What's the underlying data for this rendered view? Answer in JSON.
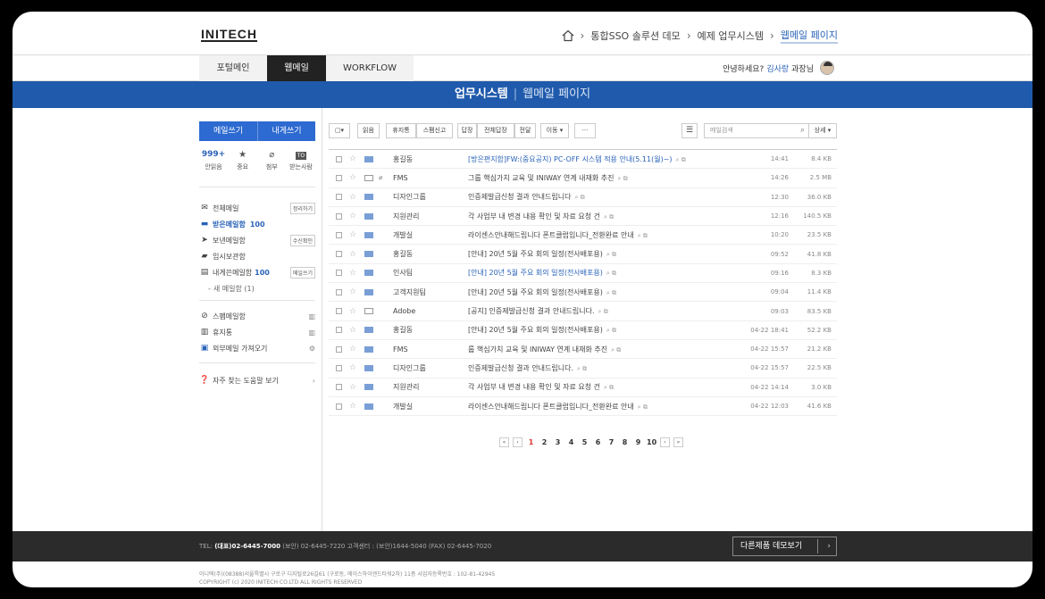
{
  "header": {
    "logo": "INITECH",
    "breadcrumb": [
      "통합SSO 솔루션 데모",
      "예제 업무시스템",
      "웹메일 페이지"
    ]
  },
  "nav": {
    "tabs": [
      "포털메인",
      "웹메일",
      "WORKFLOW"
    ],
    "active_tab": "웹메일",
    "greeting": "안녕하세요?",
    "user_name": "김사랑",
    "user_title": "과장님"
  },
  "banner": {
    "title": "업무시스템",
    "subtitle": "웹메일 페이지"
  },
  "sidebar": {
    "write_mail": "메일쓰기",
    "write_self": "내게쓰기",
    "quick": [
      {
        "value": "999+",
        "label": "안읽음"
      },
      {
        "icon": "star-icon",
        "label": "중요"
      },
      {
        "icon": "clip-icon",
        "label": "첨부"
      },
      {
        "badge": "TO",
        "label": "받는사람"
      }
    ],
    "menu": [
      {
        "label": "전체메일",
        "action": "정리하기",
        "icon": "mail-icon"
      },
      {
        "label": "받은메일함",
        "count": "100",
        "icon": "inbox-icon",
        "active": true
      },
      {
        "label": "보낸메일함",
        "action": "수신확인",
        "icon": "send-icon"
      },
      {
        "label": "임시보관함",
        "icon": "folder-icon"
      },
      {
        "label": "내게쓴메일함",
        "count": "100",
        "action": "메일쓰기",
        "icon": "note-icon"
      },
      {
        "label": "새 메일함 (1)",
        "sub": true
      }
    ],
    "menu2": [
      {
        "label": "스팸메일함",
        "icon": "block-icon"
      },
      {
        "label": "휴지통",
        "icon": "trash-icon"
      },
      {
        "label": "외부메일 가져오기",
        "icon": "import-icon"
      }
    ],
    "help": "자주 찾는 도움말 보기"
  },
  "toolbar": {
    "buttons": [
      "읽음",
      "휴지통",
      "스팸신고",
      "답장",
      "전체답장",
      "전달",
      "이동",
      "···"
    ],
    "search_placeholder": "메일검색",
    "detail": "상세"
  },
  "mails": [
    {
      "sender": "홍길동",
      "subject": "[방은편지함]FW:(중요공지) PC-OFF 시스템 적용 안내(5.11(월)~)",
      "date": "14:41",
      "size": "8.4 KB",
      "blue": true,
      "read": false,
      "attach": false
    },
    {
      "sender": "FMS",
      "subject": "그룹 핵심가치 교육 및 INIWAY 연계 내재화 추진",
      "date": "14:26",
      "size": "2.5 MB",
      "blue": false,
      "read": true,
      "attach": true
    },
    {
      "sender": "디자인그룹",
      "subject": "인증제발급신청 결과 안내드립니다",
      "date": "12:30",
      "size": "36.0 KB",
      "blue": false,
      "read": false,
      "attach": false
    },
    {
      "sender": "지원관리",
      "subject": "각 사업부 내 변경 내용 확인 및 자료 요청 건",
      "date": "12:16",
      "size": "140.5 KB",
      "blue": false,
      "read": false,
      "attach": false
    },
    {
      "sender": "개발실",
      "subject": "라이센스안내해드립니다 폰트클럽입니다_전환완료 안내",
      "date": "10:20",
      "size": "23.5 KB",
      "blue": false,
      "read": false,
      "attach": false
    },
    {
      "sender": "홍길동",
      "subject": "[안내] 20년 5월 주요 회의 일정(전사배포용)",
      "date": "09:52",
      "size": "41.8 KB",
      "blue": false,
      "read": false,
      "attach": false
    },
    {
      "sender": "인사팀",
      "subject": "[안내] 20년 5월 주요 회의 일정(전사배포용)",
      "date": "09:16",
      "size": "8.3 KB",
      "blue": true,
      "read": false,
      "attach": false
    },
    {
      "sender": "고객지원팀",
      "subject": "[안내] 20년 5월 주요 회의 일정(전사배포용)",
      "date": "09:04",
      "size": "11.4 KB",
      "blue": false,
      "read": false,
      "attach": false
    },
    {
      "sender": "Adobe",
      "subject": "[공지] 인증제발급신청 결과 안내드립니다.",
      "date": "09:03",
      "size": "83.5 KB",
      "blue": false,
      "read": true,
      "attach": false
    },
    {
      "sender": "홍길동",
      "subject": "[안내] 20년 5월 주요 회의 일정(전사배포용)",
      "date": "04-22 18:41",
      "size": "52.2 KB",
      "blue": false,
      "read": false,
      "attach": false
    },
    {
      "sender": "FMS",
      "subject": "룹 핵심가치 교육 및 INIWAY 연계 내재화 추진",
      "date": "04-22 15:57",
      "size": "21.2 KB",
      "blue": false,
      "read": false,
      "attach": false
    },
    {
      "sender": "디자인그룹",
      "subject": "인증제발급신청 결과 안내드립니다.",
      "date": "04-22 15:57",
      "size": "22.5 KB",
      "blue": false,
      "read": false,
      "attach": false
    },
    {
      "sender": "지원관리",
      "subject": "각 사업부 내 변경 내용 확인 및 자료 요청 건",
      "date": "04-22 14:14",
      "size": "3.0 KB",
      "blue": false,
      "read": false,
      "attach": false
    },
    {
      "sender": "개발실",
      "subject": "라이센스안내해드립니다 폰트클럽입니다_전환완료 안내",
      "date": "04-22 12:03",
      "size": "41.6 KB",
      "blue": false,
      "read": false,
      "attach": false
    }
  ],
  "pager": {
    "pages": [
      "1",
      "2",
      "3",
      "4",
      "5",
      "6",
      "7",
      "8",
      "9",
      "10"
    ],
    "current": "1"
  },
  "footer": {
    "tel_label": "TEL:",
    "tel_main": "(대표)02-6445-7000",
    "tel_rest": "(보안) 02-6445-7220   고객센터 : (보안)1644-5040   (FAX) 02-6445-7020",
    "demo_button": "다른제품 데모보기",
    "address": "이니텍(주)(08388)서울특별시 구로구 디지털로26길61 (구로동, 에이스하이엔드타워2차) 11층 사업자등록번호 : 102-81-42945",
    "copyright": "COPYRIGHT (c) 2020 INITECH CO.LTD ALL RIGHTS RESERVED"
  },
  "colors": {
    "brand": "#1f5aac",
    "accent": "#2d6ad1",
    "dark": "#2b2b2b"
  }
}
